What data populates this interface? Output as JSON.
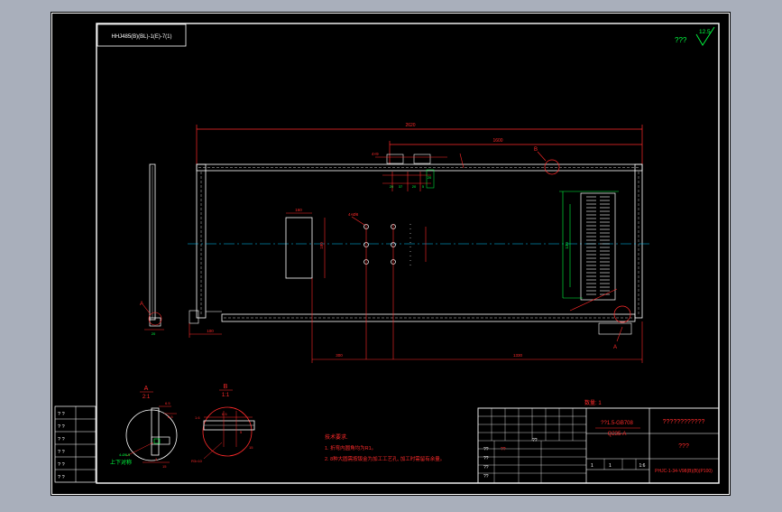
{
  "drawing": {
    "header_code": "HHJ485(B)(BL)-1(E)-7(1)",
    "roughness_prefix": "???",
    "roughness_value": "12.5",
    "dimensions": {
      "overall_length": "2620",
      "right_offset": "1600",
      "top_d1": "4×9",
      "top_d2": "20",
      "top_d3": "37",
      "top_d4": "20",
      "top_d5": "5",
      "top_d6": "20",
      "hole_label": "4×Ø8",
      "rect_width": "160",
      "rect_height": "180",
      "slot_length": "130",
      "bottom_left": "100",
      "bottom_a": "300",
      "bottom_b": "1330",
      "vert_small": "20"
    },
    "callouts": {
      "b_label": "B",
      "a_label": "A",
      "detail_a_title": "A",
      "detail_a_scale": "2:1",
      "detail_b_title": "B",
      "detail_b_scale": "1:1",
      "detail_a_dim1": "6.5",
      "detail_a_dim2": "6.5",
      "detail_a_dim3": "4-Ø8.5",
      "detail_a_dim4": "3",
      "detail_a_dim5": "15",
      "detail_a_label": "上下对称",
      "detail_b_dim1": "6.5",
      "detail_b_dim2": "1.6",
      "detail_b_dim3": "5",
      "detail_b_dim4": "R3×10",
      "detail_b_dim5": "15"
    },
    "notes": {
      "title": "技术要求.",
      "line1": "1. 折弯内圆角均为R1。",
      "line2": "2. 8种大圆需按钣金为加工工艺孔, 加工时需留有余量。"
    },
    "quantity": "数量: 1",
    "title_block": {
      "standard": "??1.5-GB708",
      "material": "Q235-A",
      "product": "????????????",
      "name": "???",
      "code": "PHJC-1-34-V98(B)(B)(P100)",
      "scale": "1:6",
      "row_a": "??",
      "row_b": "??",
      "row_c": "??",
      "row_d": "??",
      "row_e": "??",
      "sig": "??",
      "sheet": "1",
      "sheets": "1"
    },
    "revision_block": [
      "? ?",
      "? ?",
      "? ?",
      "? ?",
      "? ?",
      "? ?"
    ],
    "colors": {
      "background": "#000000",
      "frame": "#ffffff",
      "dimension": "#ff2a2a",
      "geometry": "#ffffff",
      "annotation": "#00ff40",
      "centerline": "#00c8ff"
    }
  }
}
